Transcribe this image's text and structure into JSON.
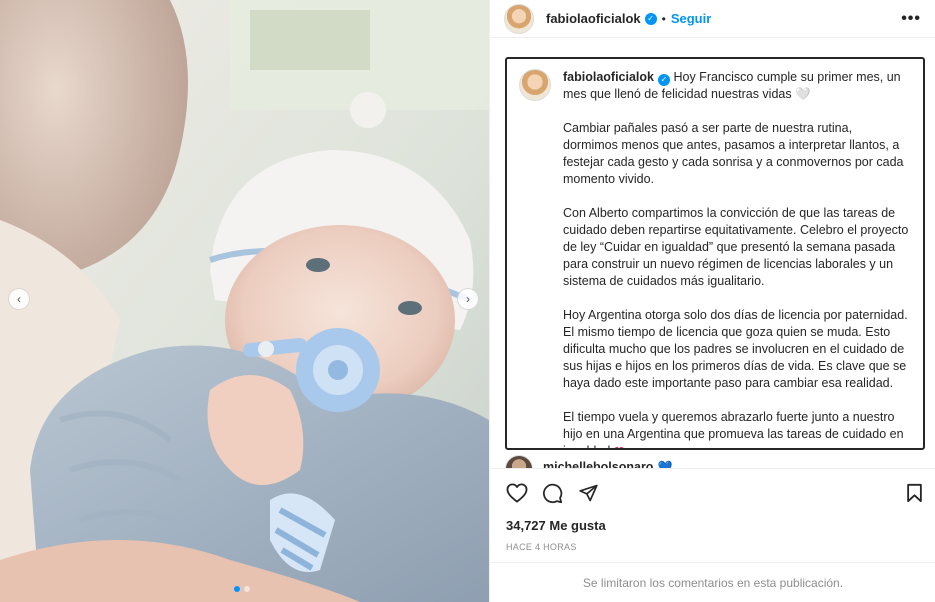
{
  "post": {
    "username": "fabiolaoficialok",
    "separator": "•",
    "follow_label": "Seguir",
    "more_label": "•••",
    "verified_mark": "✓"
  },
  "caption": {
    "intro": "Hoy Francisco cumple su primer mes, un mes que llenó de felicidad nuestras vidas 🤍",
    "paragraphs": [
      "Cambiar pañales pasó a ser parte de nuestra rutina, dormimos menos que antes, pasamos a interpretar llantos, a festejar cada gesto y cada sonrisa y a conmovernos por cada momento vivido.",
      "Con Alberto compartimos la convicción de que las tareas de cuidado deben repartirse equitativamente. Celebro el proyecto de ley “Cuidar en igualdad” que presentó la semana pasada para construir un nuevo régimen de licencias laborales y un sistema de cuidados más igualitario.",
      "Hoy Argentina otorga solo dos días de licencia por paternidad. El mismo tiempo de licencia que goza quien se muda. Esto dificulta mucho que los padres se involucren en el cuidado de sus hijas e hijos en los primeros días de vida. Es clave que se haya dado este importante paso para cambiar esa realidad.",
      "El tiempo vuela y queremos abrazarlo fuerte junto a nuestro hijo en una Argentina que promueva las tareas de cuidado en igualdad"
    ],
    "heart": "❤",
    "timestamp": "4 h"
  },
  "comment_peek": {
    "username": "michellebolsonaro",
    "emoji": "💙"
  },
  "engagement": {
    "likes": "34,727 Me gusta",
    "time_ago": "HACE 4 HORAS",
    "comments_limited": "Se limitaron los comentarios en esta publicación."
  },
  "carousel": {
    "prev": "‹",
    "next": "›",
    "slides": 2,
    "active_index": 0
  },
  "colors": {
    "accent": "#0095f6",
    "heart": "#e0245e",
    "muted": "#8e8e8e"
  }
}
